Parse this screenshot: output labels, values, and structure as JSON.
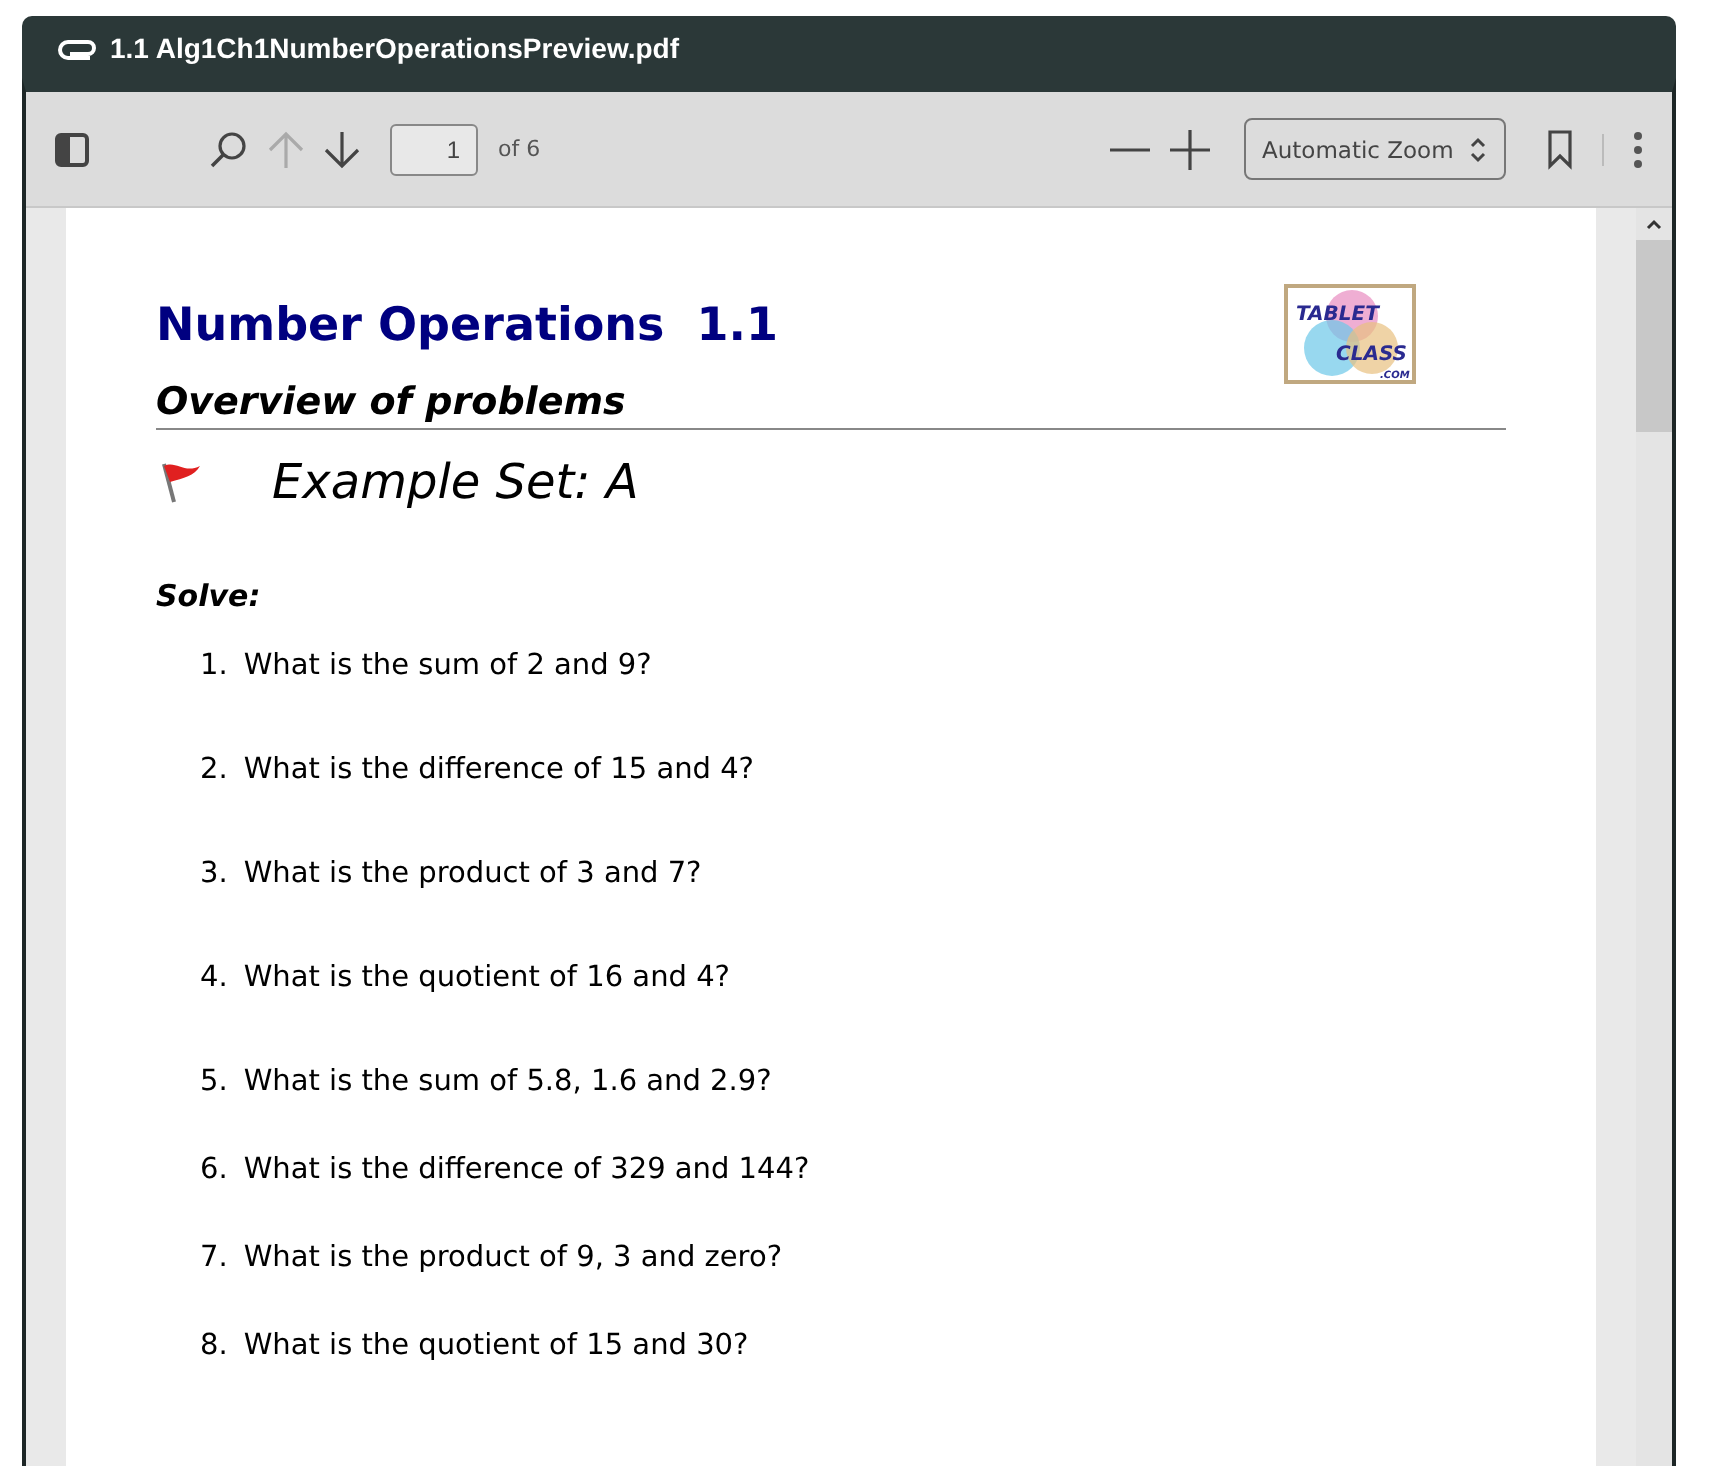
{
  "window": {
    "title": "1.1 Alg1Ch1NumberOperationsPreview.pdf"
  },
  "toolbar": {
    "page_number": "1",
    "page_count": "of 6",
    "zoom": "Automatic Zoom"
  },
  "document": {
    "title": "Number Operations  1.1",
    "logo": [
      "TABLET",
      "CLASS",
      ".COM"
    ],
    "subtitle": "Overview of problems",
    "example_set": "Example Set: A",
    "instruction": "Solve:",
    "problems": [
      {
        "number": "1.",
        "text": "What is the sum of 2 and 9?"
      },
      {
        "number": "2.",
        "text": "What is the difference of 15 and 4?"
      },
      {
        "number": "3.",
        "text": "What is the product of 3 and 7?"
      },
      {
        "number": "4.",
        "text": "What is the quotient of 16 and 4?"
      },
      {
        "number": "5.",
        "text": "What is the sum of 5.8, 1.6 and 2.9?"
      },
      {
        "number": "6.",
        "text": "What is the difference of 329 and 144?"
      },
      {
        "number": "7.",
        "text": "What is the product of 9, 3 and zero?"
      },
      {
        "number": "8.",
        "text": "What is the quotient of 15 and 30?"
      }
    ]
  }
}
